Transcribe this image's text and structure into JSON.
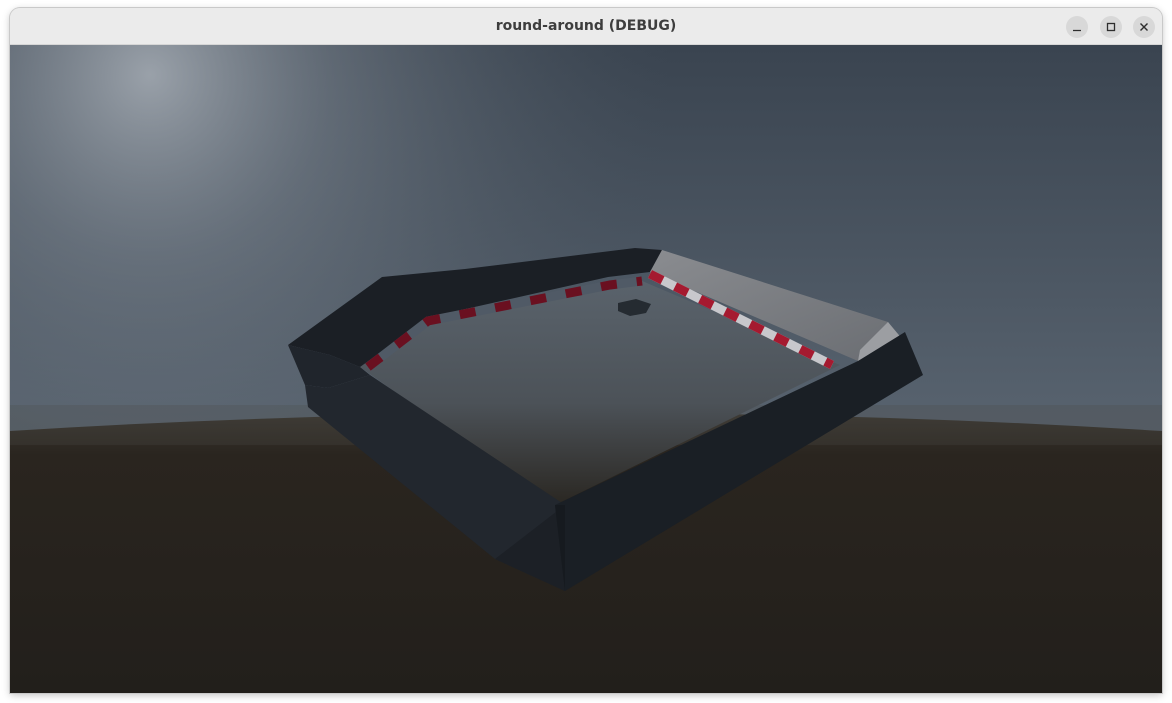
{
  "window": {
    "title": "round-around (DEBUG)"
  },
  "controls": {
    "minimize_icon": "minimize-icon",
    "maximize_icon": "maximize-icon",
    "close_icon": "close-icon"
  },
  "scene": {
    "sky_top_color": "#353f4b",
    "sky_glow_color": "#9aa3ad",
    "ground_color": "#231f1a",
    "wall_color": "#1d2229",
    "barrier_color": "#707378",
    "kerb_red": "#a51a30",
    "kerb_white": "#c8c8cc"
  }
}
